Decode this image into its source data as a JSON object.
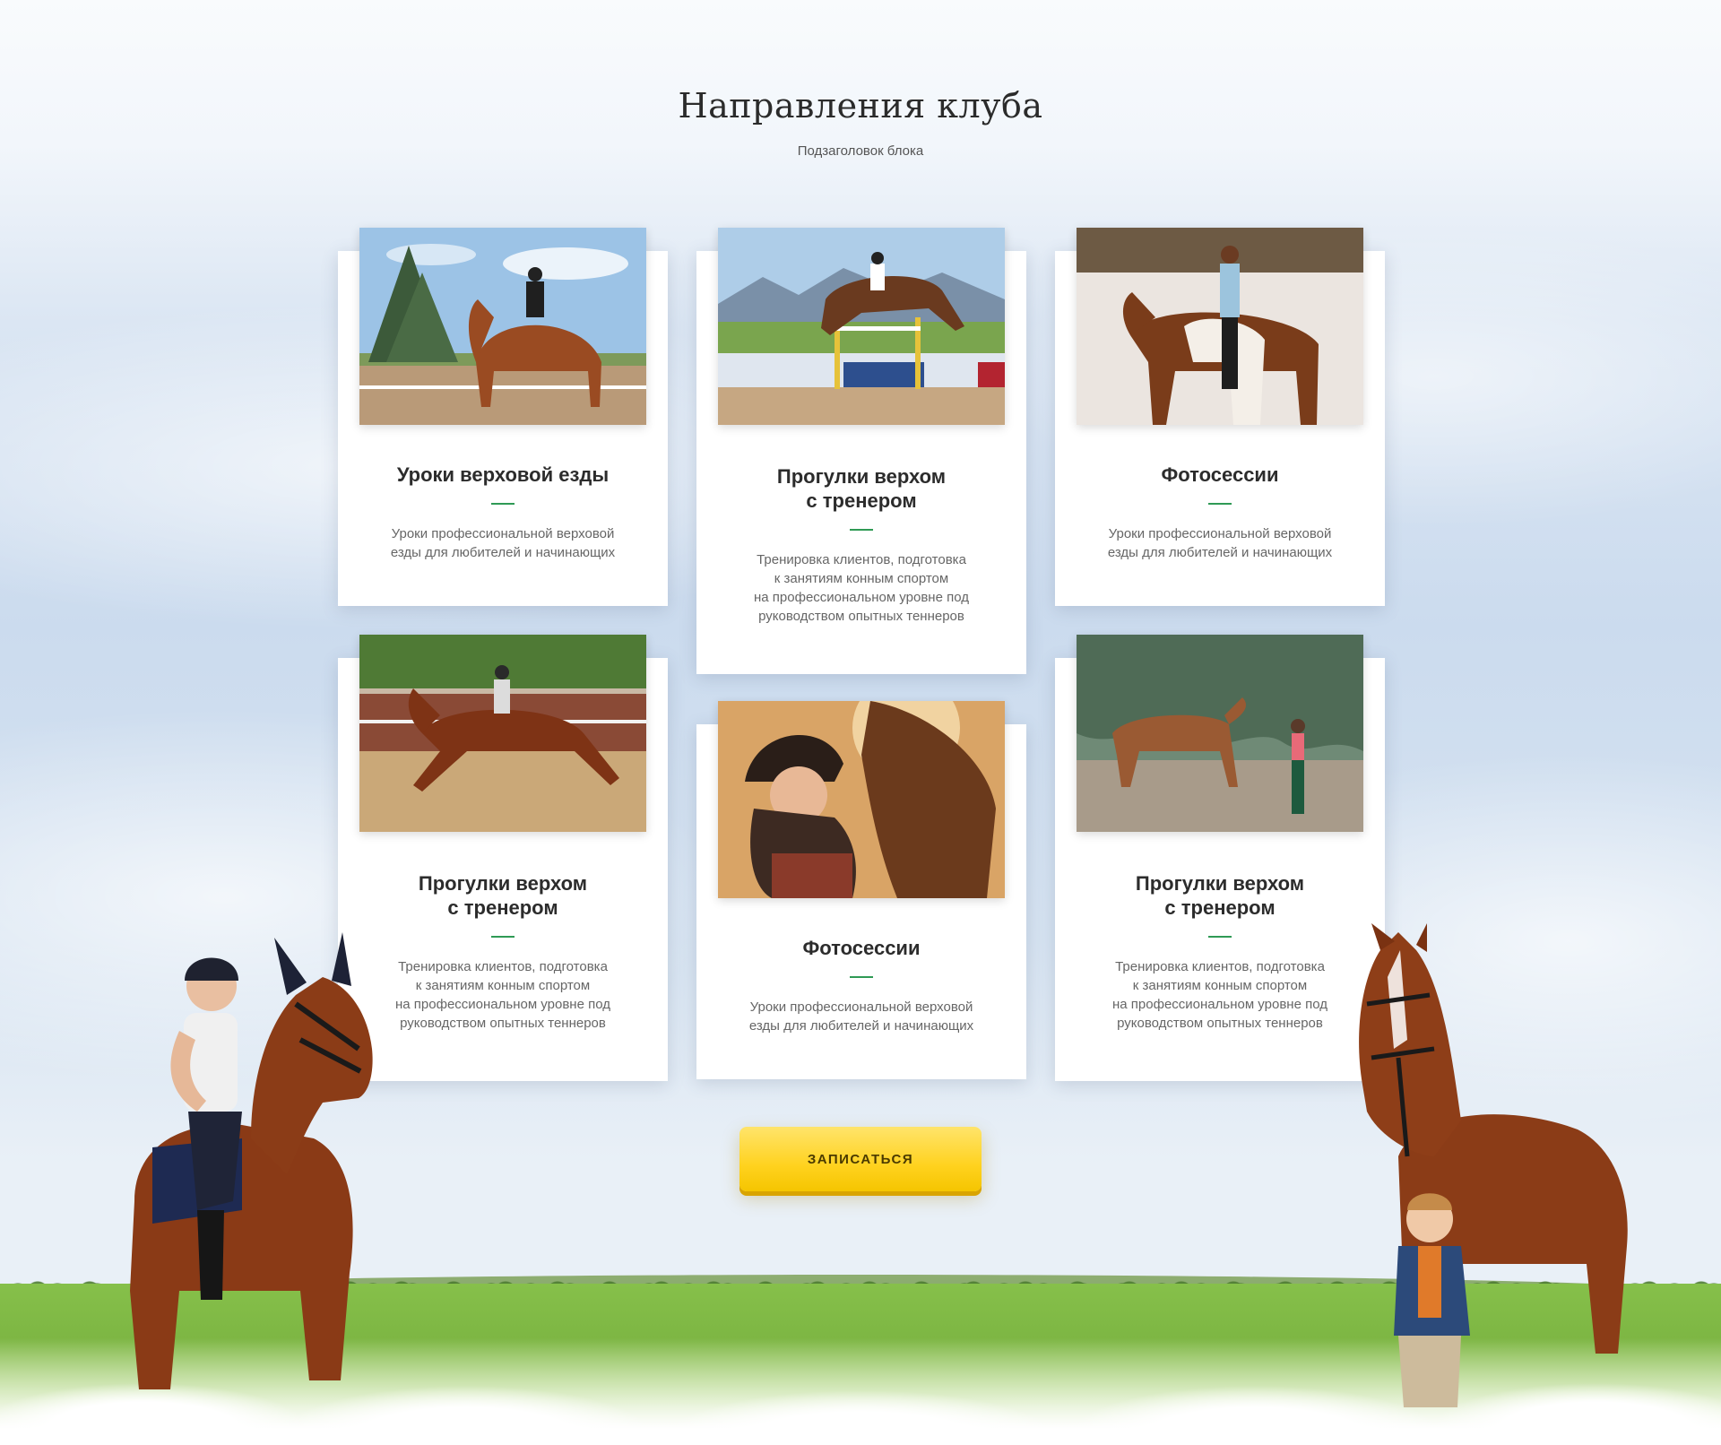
{
  "header": {
    "title": "Направления клуба",
    "subtitle": "Подзаголовок блока"
  },
  "cards": [
    {
      "title_line1": "Уроки верховой езды",
      "title_line2": "",
      "text": [
        "Уроки профессиональной верховой",
        "езды для любителей и начинающих"
      ],
      "photo": "dressage-rider-photo"
    },
    {
      "title_line1": "Прогулки верхом",
      "title_line2": "с тренером",
      "text": [
        "Тренировка клиентов, подготовка",
        "к занятиям конным спортом",
        "на профессиональном уровне под",
        "руководством опытных теннеров"
      ],
      "photo": "show-jumping-photo"
    },
    {
      "title_line1": "Фотосессии",
      "title_line2": "",
      "text": [
        "Уроки профессиональной верховой",
        "езды для любителей и начинающих"
      ],
      "photo": "woman-on-pinto-horse-photo"
    },
    {
      "title_line1": "Прогулки верхом",
      "title_line2": "с тренером",
      "text": [
        "Тренировка клиентов, подготовка",
        "к занятиям конным спортом",
        "на профессиональном уровне под",
        "руководством опытных теннеров"
      ],
      "photo": "arena-trot-photo"
    },
    {
      "title_line1": "Фотосессии",
      "title_line2": "",
      "text": [
        "Уроки профессиональной верховой",
        "езды для любителей и начинающих"
      ],
      "photo": "woman-hugging-horse-photo"
    },
    {
      "title_line1": "Прогулки верхом",
      "title_line2": "с тренером",
      "text": [
        "Тренировка клиентов, подготовка",
        "к занятиям конным спортом",
        "на профессиональном уровне под",
        "руководством опытных теннеров"
      ],
      "photo": "woman-leading-horse-photo"
    }
  ],
  "cta": {
    "label": "ЗАПИСАТЬСЯ"
  },
  "colors": {
    "accent_green": "#2f9a55",
    "button_yellow": "#ffd21f"
  }
}
